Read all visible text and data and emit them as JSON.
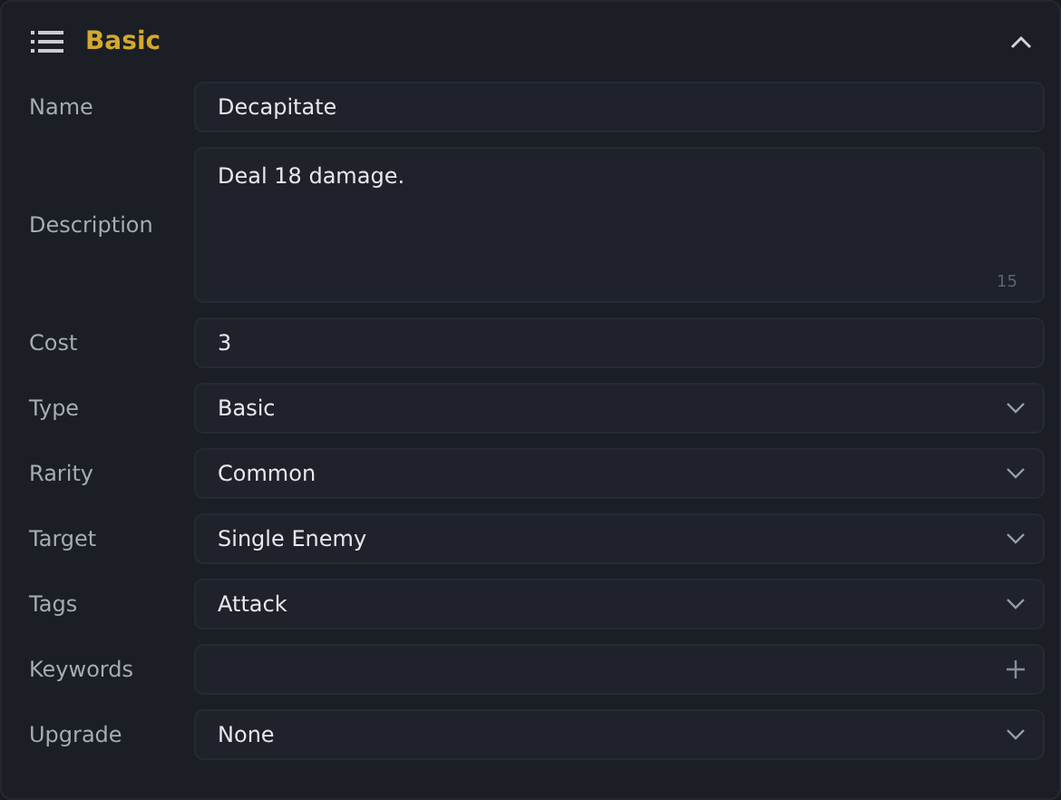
{
  "section": {
    "title": "Basic",
    "expanded": true
  },
  "fields": [
    {
      "label": "Name",
      "kind": "text",
      "value": "Decapitate"
    },
    {
      "label": "Description",
      "kind": "textarea",
      "value": "Deal 18 damage.",
      "counter": "15"
    },
    {
      "label": "Cost",
      "kind": "text",
      "value": "3"
    },
    {
      "label": "Type",
      "kind": "select",
      "value": "Basic"
    },
    {
      "label": "Rarity",
      "kind": "select",
      "value": "Common"
    },
    {
      "label": "Target",
      "kind": "select",
      "value": "Single Enemy"
    },
    {
      "label": "Tags",
      "kind": "select",
      "value": "Attack"
    },
    {
      "label": "Keywords",
      "kind": "tags"
    },
    {
      "label": "Upgrade",
      "kind": "select",
      "value": "None"
    }
  ]
}
